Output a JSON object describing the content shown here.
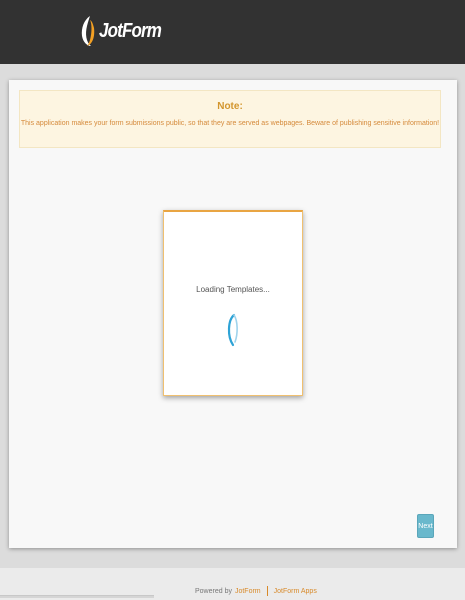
{
  "header": {
    "logo_text": "JotForm"
  },
  "note": {
    "title": "Note:",
    "message": "This application makes your form submissions public, so that they are served as webpages. Beware of publishing sensitive information!"
  },
  "loader": {
    "text": "Loading Templates..."
  },
  "actions": {
    "next_label": "Next"
  },
  "footer": {
    "powered_by": "Powered by",
    "jotform_link": "JotForm",
    "apps_link": "JotForm Apps"
  },
  "colors": {
    "header_bg": "#323232",
    "note_bg": "#fdf5e1",
    "note_text": "#d58a3b",
    "accent": "#e9a543",
    "next_button": "#69b8cc",
    "spinner": "#2ea3d6"
  }
}
